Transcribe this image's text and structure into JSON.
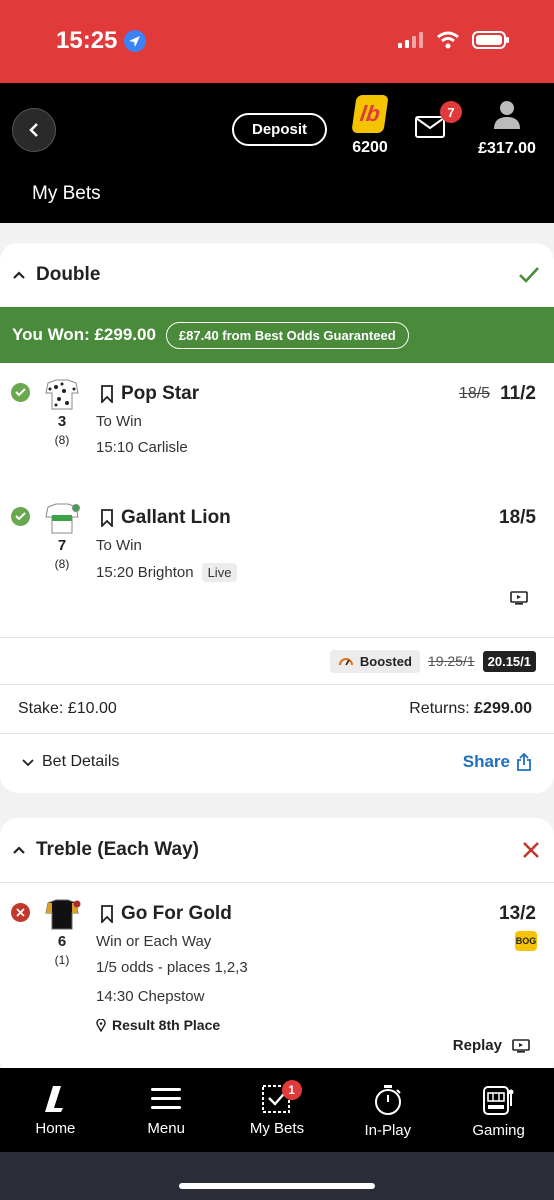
{
  "status_bar": {
    "time": "15:25"
  },
  "header": {
    "deposit_label": "Deposit",
    "loyalty_logo": "lb",
    "loyalty_points": "6200",
    "mail_count": "7",
    "balance": "£317.00",
    "page_title": "My Bets"
  },
  "bet1": {
    "title": "Double",
    "won_text": "You Won: £299.00",
    "bog_text": "£87.40 from Best Odds Guaranteed",
    "selections": [
      {
        "name": "Pop Star",
        "number": "3",
        "draw": "(8)",
        "market": "To Win",
        "race": "15:10 Carlisle",
        "odds_old": "18/5",
        "odds": "11/2"
      },
      {
        "name": "Gallant Lion",
        "number": "7",
        "draw": "(8)",
        "market": "To Win",
        "race": "15:20 Brighton",
        "live": "Live",
        "odds": "18/5"
      }
    ],
    "boosted_label": "Boosted",
    "boost_old": "19.25/1",
    "boost_new": "20.15/1",
    "stake": "Stake: £10.00",
    "returns_label": "Returns:",
    "returns_value": "£299.00",
    "details_label": "Bet Details",
    "share_label": "Share"
  },
  "bet2": {
    "title": "Treble (Each Way)",
    "selection": {
      "name": "Go For Gold",
      "number": "6",
      "draw": "(1)",
      "market": "Win or Each Way",
      "terms": "1/5 odds - places 1,2,3",
      "race": "14:30 Chepstow",
      "result": "Result 8th Place",
      "odds": "13/2",
      "bog_badge": "BOG",
      "replay_label": "Replay"
    }
  },
  "bottom_nav": {
    "items": [
      {
        "label": "Home",
        "icon": "home-logo-icon"
      },
      {
        "label": "Menu",
        "icon": "menu-icon"
      },
      {
        "label": "My Bets",
        "icon": "my-bets-icon",
        "badge": "1"
      },
      {
        "label": "In-Play",
        "icon": "stopwatch-icon"
      },
      {
        "label": "Gaming",
        "icon": "slot-machine-icon"
      }
    ]
  },
  "colors": {
    "status_red": "#e03a3a",
    "won_green": "#4a8b3b",
    "link_blue": "#1f6fbf",
    "bog_yellow": "#f5c400"
  }
}
